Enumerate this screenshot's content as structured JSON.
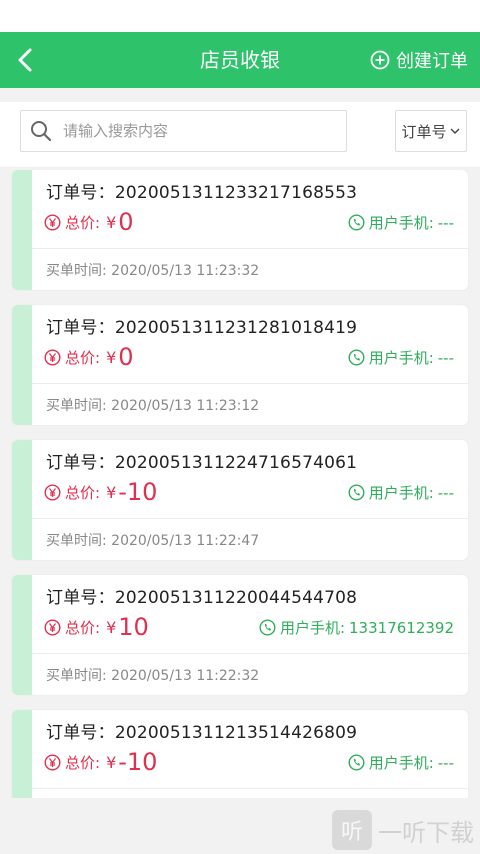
{
  "header": {
    "title": "店员收银",
    "create_label": "创建订单"
  },
  "search": {
    "placeholder": "请输入搜索内容",
    "filter_label": "订单号"
  },
  "orders": [
    {
      "order_label": "订单号：",
      "order_no": "20200513112332171685​53",
      "total_label": "总价:",
      "currency": "¥",
      "total": "0",
      "phone_label": "用户手机:",
      "phone": "---",
      "time_label": "买单时间:",
      "time": "2020/05/13 11:23:32"
    },
    {
      "order_label": "订单号：",
      "order_no": "20200513112312810184​19",
      "total_label": "总价:",
      "currency": "¥",
      "total": "0",
      "phone_label": "用户手机:",
      "phone": "---",
      "time_label": "买单时间:",
      "time": "2020/05/13 11:23:12"
    },
    {
      "order_label": "订单号：",
      "order_no": "20200513112247165740​61",
      "total_label": "总价:",
      "currency": "¥",
      "total": "-10",
      "phone_label": "用户手机:",
      "phone": "---",
      "time_label": "买单时间:",
      "time": "2020/05/13 11:22:47"
    },
    {
      "order_label": "订单号：",
      "order_no": "20200513112200445447​08",
      "total_label": "总价:",
      "currency": "¥",
      "total": "10",
      "phone_label": "用户手机:",
      "phone": "13317612392",
      "time_label": "买单时间:",
      "time": "2020/05/13 11:22:32"
    },
    {
      "order_label": "订单号：",
      "order_no": "20200513112135144268​09",
      "total_label": "总价:",
      "currency": "¥",
      "total": "-10",
      "phone_label": "用户手机:",
      "phone": "---",
      "time_label": "",
      "time": ""
    }
  ],
  "watermark": {
    "icon_text": "听",
    "text": "一听下载"
  },
  "colors": {
    "brand": "#2ec26a",
    "price": "#e0304f",
    "phone": "#2fae5b",
    "accent_bar": "#c8f0d6"
  },
  "icons": {
    "back": "chevron-left-icon",
    "create": "plus-circle-icon",
    "search": "search-icon",
    "filter": "chevron-down-icon",
    "price": "yen-circle-icon",
    "phone": "phone-circle-icon"
  }
}
